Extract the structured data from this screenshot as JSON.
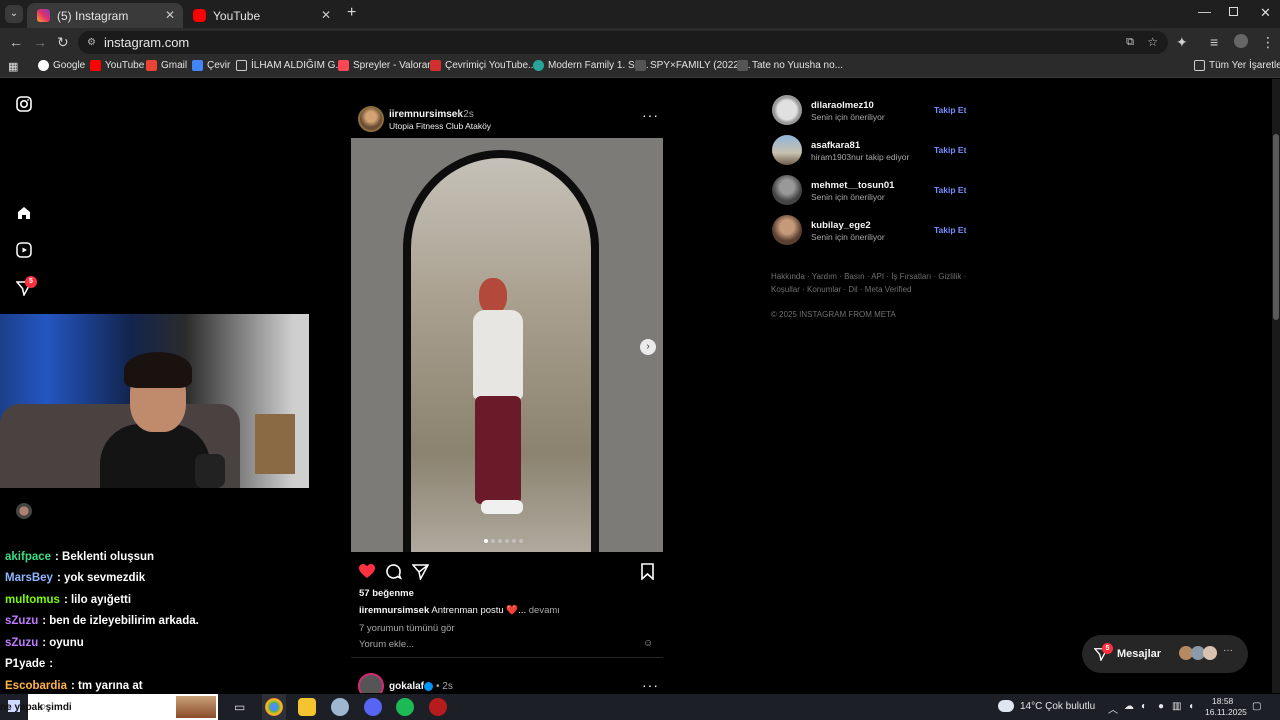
{
  "browser": {
    "tabs": [
      {
        "title": "(5) Instagram",
        "active": true
      },
      {
        "title": "YouTube",
        "active": false
      }
    ],
    "url": "instagram.com",
    "bookmarks": [
      "Google",
      "YouTube",
      "Gmail",
      "Çevir",
      "İLHAM ALDIĞIM G...",
      "Spreyler - Valorant",
      "Çevrimiçi YouTube...",
      "Modern Family 1. Se...",
      "SPY×FAMILY (2022)...",
      "Tate no Yuusha no..."
    ],
    "all_bookmarks": "Tüm Yer İşaretleri"
  },
  "sidebar": {
    "notification_count": "5"
  },
  "post": {
    "username": "iiremnursimsek",
    "time": "• 2s",
    "location": "Utopia Fitness Club Ataköy",
    "likes": "57 beğenme",
    "caption_user": "iiremnursimsek",
    "caption_text": "Antrenman postu ❤️...",
    "caption_more": "devamı",
    "view_comments": "7 yorumun tümünü gör",
    "comment_placeholder": "Yorum ekle...",
    "more_icon": "more-horizontal-icon"
  },
  "next_post": {
    "username": "gokalaf",
    "time": "• 2s"
  },
  "suggestions": [
    {
      "name": "dilaraolmez10",
      "sub": "Senin için öneriliyor",
      "action": "Takip Et"
    },
    {
      "name": "asafkara81",
      "sub": "hiram1903nur takip ediyor",
      "action": "Takip Et"
    },
    {
      "name": "mehmet__tosun01",
      "sub": "Senin için öneriliyor",
      "action": "Takip Et"
    },
    {
      "name": "kubilay_ege2",
      "sub": "Senin için öneriliyor",
      "action": "Takip Et"
    }
  ],
  "footer": {
    "links_line1": "Hakkında · Yardım · Basın · API · İş Fırsatları · Gizlilik ·",
    "links_line2": "Koşullar · Konumlar · Dil · Meta Verified",
    "copyright": "© 2025 INSTAGRAM FROM META"
  },
  "messages": {
    "label": "Mesajlar",
    "count": "5"
  },
  "chat": [
    {
      "user": "akifpace",
      "text": ": Beklenti oluşsun",
      "color": "#3ddc84"
    },
    {
      "user": "MarsBey",
      "text": ": yok sevmezdik",
      "color": "#8fb6ff"
    },
    {
      "user": "multomus",
      "text": ": lilo ayığetti",
      "color": "#7cfc00"
    },
    {
      "user": "sZuzu",
      "text": ": ben de izleyebilirim arkada.",
      "color": "#c17bff"
    },
    {
      "user": "sZuzu",
      "text": ": oyunu",
      "color": "#c17bff"
    },
    {
      "user": "P1yade",
      "text": ":",
      "color": "#ffffff"
    },
    {
      "user": "Escobardia",
      "text": ": tm yarına at",
      "color": "#ffb347"
    }
  ],
  "taskbar": {
    "search_text": "ne yapak şimdi",
    "weather": "14°C  Çok bulutlu",
    "time": "18:58",
    "date": "16.11.2025"
  }
}
